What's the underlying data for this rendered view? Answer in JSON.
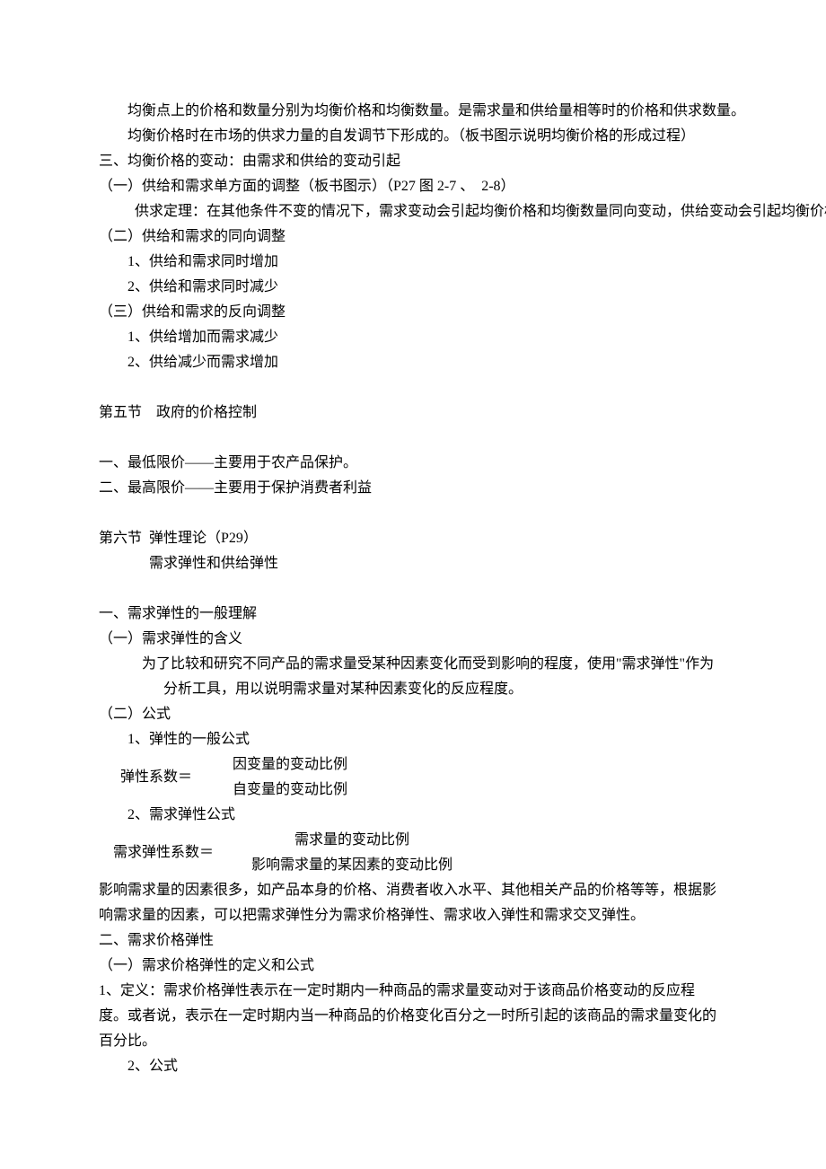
{
  "paragraphs": {
    "p1": "        均衡点上的价格和数量分别为均衡价格和均衡数量。是需求量和供给量相等时的价格和供求数量。",
    "p2": "        均衡价格时在市场的供求力量的自发调节下形成的。（板书图示说明均衡价格的形成过程）",
    "h3": "三、均衡价格的变动：由需求和供给的变动引起",
    "s3_1": "（一）供给和需求单方面的调整（板书图示）（P27 图 2-7 、  2-8）",
    "s3_1_body": "          供求定理：在其他条件不变的情况下，需求变动会引起均衡价格和均衡数量同向变动，供给变动会引起均衡价格的反向变动，均衡数量的同向变动",
    "s3_2": "（二）供给和需求的同向调整",
    "s3_2_1": "1、供给和需求同时增加",
    "s3_2_2": "2、供给和需求同时减少",
    "s3_3": "（三）供给和需求的反向调整",
    "s3_3_1": "1、供给增加而需求减少",
    "s3_3_2": "2、供给减少而需求增加",
    "sec5": "第五节    政府的价格控制",
    "sec5_1": "一、最低限价——主要用于农产品保护。",
    "sec5_2": "二、最高限价——主要用于保护消费者利益",
    "sec6": "第六节  弹性理论（P29）",
    "sec6_sub": "需求弹性和供给弹性",
    "h_a": "一、需求弹性的一般理解",
    "a1": "（一）需求弹性的含义",
    "a1_body": "          为了比较和研究不同产品的需求量受某种因素变化而受到影响的程度，使用\"需求弹性\"作为分析工具，用以说明需求量对某种因素变化的反应程度。",
    "a1_body_wrap": "性\"作为分析工具，用以说明需求量对某种因素变化的反应程度。",
    "a2": "（二）公式",
    "a2_1": "1、弹性的一般公式",
    "eq1_label": "      弹性系数＝      ",
    "eq1_num": "因变量的变动比例",
    "eq1_den": "自变量的变动比例",
    "a2_2": "2、需求弹性公式",
    "eq2_label": "    需求弹性系数＝      ",
    "eq2_num": "需求量的变动比例",
    "eq2_den": "影响需求量的某因素的变动比例",
    "b_body": "    影响需求量的因素很多，如产品本身的价格、消费者收入水平、其他相关产品的价格等等，根据影响需求量的因素，可以把需求弹性分为需求价格弹性、需求收入弹性和需求交叉弹性。",
    "h_b": "二、需求价格弹性",
    "b1": "（一）需求价格弹性的定义和公式",
    "b1_1": "    1、定义：需求价格弹性表示在一定时期内一种商品的需求量变动对于该商品价格变动的反应程度。或者说，表示在一定时期内当一种商品的价格变化百分之一时所引起的该商品的需求量变化的百分比。",
    "b1_2": "2、公式"
  }
}
